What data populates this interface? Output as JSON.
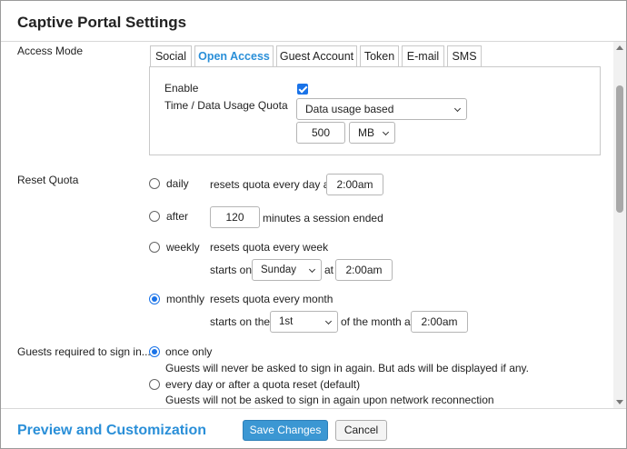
{
  "dialog": {
    "title": "Captive Portal Settings"
  },
  "access_mode": {
    "label": "Access Mode",
    "tabs": [
      "Social",
      "Open Access",
      "Guest Account",
      "Token",
      "E-mail",
      "SMS"
    ],
    "active_tab": "Open Access",
    "enable_label": "Enable",
    "enable_checked": true,
    "quota_label": "Time / Data Usage Quota",
    "quota_type": "Data usage based",
    "quota_amount": "500",
    "quota_unit": "MB"
  },
  "reset_quota": {
    "label": "Reset Quota",
    "selected": "monthly",
    "daily": {
      "label": "daily",
      "text": "resets quota every day at",
      "time": "2:00am"
    },
    "after": {
      "label": "after",
      "minutes": "120",
      "text": "minutes a session ended"
    },
    "weekly": {
      "label": "weekly",
      "text": "resets quota every week",
      "starts_on_label": "starts on",
      "day": "Sunday",
      "at_label": "at",
      "time": "2:00am"
    },
    "monthly": {
      "label": "monthly",
      "text": "resets quota every month",
      "starts_on_label": "starts on the",
      "day": "1st",
      "of_month_label": "of the month at",
      "time": "2:00am"
    }
  },
  "guests_sign_in": {
    "label": "Guests required to sign in...",
    "selected": "once only",
    "options": [
      {
        "label": "once only",
        "description": "Guests will never be asked to sign in again. But ads will be displayed if any."
      },
      {
        "label": "every day or after a quota reset (default)",
        "description": "Guests will not be asked to sign in again upon network reconnection"
      }
    ]
  },
  "footer": {
    "preview_link": "Preview and Customization",
    "save_label": "Save Changes",
    "cancel_label": "Cancel"
  },
  "colors": {
    "accent": "#2a8fd8",
    "primary_button": "#3b97d3",
    "radio_checkbox": "#1a73e8"
  }
}
